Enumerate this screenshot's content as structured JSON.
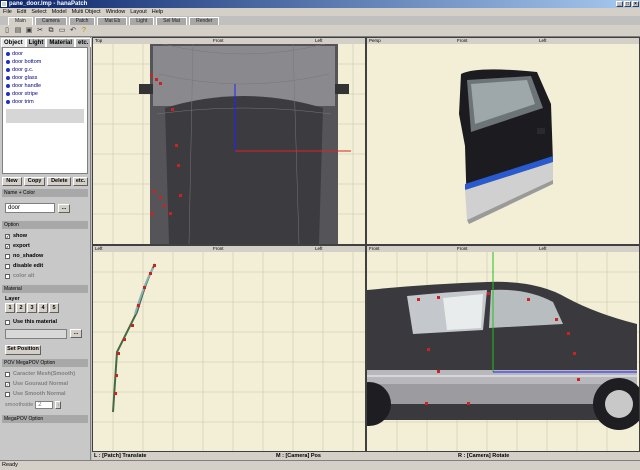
{
  "window": {
    "title": "pane_door.lmp - hanaPatch"
  },
  "menu": [
    "File",
    "Edit",
    "Select",
    "Model",
    "Multi Object",
    "Window",
    "Layout",
    "Help"
  ],
  "tabs": [
    "Main",
    "Camera",
    "Patch",
    "Mat Eb",
    "Light",
    "Sel Mat",
    "Render"
  ],
  "panel": {
    "tabs": [
      "Object",
      "Light",
      "Material",
      "etc."
    ],
    "objects": [
      "door",
      "door bottom",
      "door g.c.",
      "door glass",
      "door handle",
      "door stripe",
      "door trim"
    ],
    "buttons": [
      "New",
      "Copy",
      "Delete",
      "etc."
    ],
    "name_section": "Name + Color",
    "name_value": "door",
    "option_section": "Option",
    "options": [
      {
        "label": "show",
        "checked": true,
        "enabled": true
      },
      {
        "label": "export",
        "checked": true,
        "enabled": true
      },
      {
        "label": "no_shadow",
        "checked": false,
        "enabled": true
      },
      {
        "label": "disable edit",
        "checked": false,
        "enabled": true
      },
      {
        "label": "color alt",
        "checked": false,
        "enabled": false
      }
    ],
    "material_section": "Material",
    "layer_label": "Layer",
    "layers": [
      "1",
      "2",
      "3",
      "4",
      "5"
    ],
    "use_material": "Use this material",
    "set_position": "Set Position",
    "pov_section": "POV MegaPOV Option",
    "pov_options": [
      "Caracter Mesh(Smooth)",
      "Use Gouraud Normal",
      "Use Smooth Normal"
    ],
    "smooth_label": "smoothside",
    "smooth_value": "2",
    "megapov_section": "MegaPOV Option"
  },
  "viewports": {
    "top_left": {
      "labels": [
        "Top",
        "Front",
        "Left"
      ]
    },
    "top_right": {
      "labels": [
        "Persp",
        "Front",
        "Left"
      ]
    },
    "bottom_left": {
      "labels": [
        "Left",
        "Front",
        "Left"
      ]
    },
    "bottom_right": {
      "labels": [
        "Front",
        "Front",
        "Left"
      ]
    }
  },
  "hints": {
    "left": "L : [Patch] Translate",
    "middle": "M : [Camera] Pos",
    "right": "R : [Camera] Rotate"
  },
  "status": "Ready",
  "colors": {
    "viewport_bg": "#f2efd6",
    "grid": "#c8c6b0",
    "accent_red": "#cc2222",
    "axis_blue": "#2020ff",
    "axis_green": "#20c020"
  }
}
